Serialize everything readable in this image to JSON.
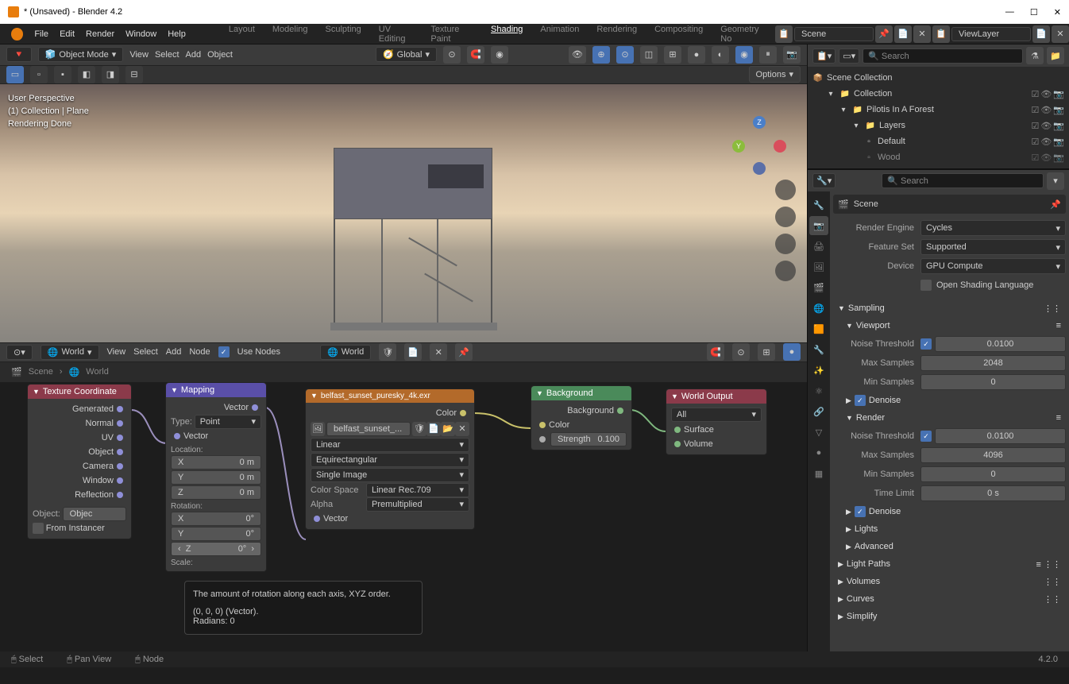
{
  "window": {
    "title": "* (Unsaved) - Blender 4.2"
  },
  "menu": [
    "File",
    "Edit",
    "Render",
    "Window",
    "Help"
  ],
  "workspaces": [
    "Layout",
    "Modeling",
    "Sculpting",
    "UV Editing",
    "Texture Paint",
    "Shading",
    "Animation",
    "Rendering",
    "Compositing",
    "Geometry No"
  ],
  "active_workspace": "Shading",
  "scene_name": "Scene",
  "viewlayer": "ViewLayer",
  "topbar": {
    "mode": "Object Mode",
    "items": [
      "View",
      "Select",
      "Add",
      "Object"
    ],
    "orientation": "Global",
    "options_label": "Options"
  },
  "viewport_info": [
    "User Perspective",
    "(1) Collection | Plane",
    "Rendering Done"
  ],
  "toolstrip_selection": true,
  "node_editor": {
    "world_dropdown": "World",
    "menu": [
      "View",
      "Select",
      "Add",
      "Node"
    ],
    "use_nodes": true,
    "breadcrumb": [
      "Scene",
      "World"
    ]
  },
  "nodes": {
    "texcoord": {
      "title": "Texture Coordinate",
      "outputs": [
        "Generated",
        "Normal",
        "UV",
        "Object",
        "Camera",
        "Window",
        "Reflection"
      ],
      "object_label": "Object:",
      "object_val": "Objec",
      "from_instancer": "From Instancer"
    },
    "mapping": {
      "title": "Mapping",
      "out": "Vector",
      "type_label": "Type:",
      "type_val": "Point",
      "vector_in": "Vector",
      "location": "Location:",
      "loc_x": "0 m",
      "loc_y": "0 m",
      "loc_z": "0 m",
      "rotation": "Rotation:",
      "rot_x": "0°",
      "rot_y": "0°",
      "rot_z": "0°",
      "scale": "Scale:"
    },
    "env": {
      "title": "belfast_sunset_puresky_4k.exr",
      "out": "Color",
      "file": "belfast_sunset_...",
      "interp": "Linear",
      "proj": "Equirectangular",
      "frame": "Single Image",
      "colorspace_lbl": "Color Space",
      "colorspace": "Linear Rec.709",
      "alpha_lbl": "Alpha",
      "alpha": "Premultiplied",
      "vec_in": "Vector"
    },
    "background": {
      "title": "Background",
      "out": "Background",
      "color_in": "Color",
      "strength_lbl": "Strength",
      "strength_val": "0.100"
    },
    "world_out": {
      "title": "World Output",
      "target": "All",
      "surface": "Surface",
      "volume": "Volume"
    }
  },
  "tooltip": {
    "line1": "The amount of rotation along each axis, XYZ order.",
    "line2": "(0, 0, 0) (Vector).",
    "line3": "Radians: 0"
  },
  "outliner": {
    "root": "Scene Collection",
    "items": [
      {
        "indent": 1,
        "label": "Collection",
        "icon": "📁"
      },
      {
        "indent": 2,
        "label": "Pilotis In A Forest",
        "icon": "📁"
      },
      {
        "indent": 3,
        "label": "Layers",
        "icon": "📁"
      },
      {
        "indent": 4,
        "label": "Default",
        "icon": "▫"
      },
      {
        "indent": 4,
        "label": "Wood",
        "icon": "▫",
        "dim": true
      }
    ]
  },
  "props": {
    "scene_label": "Scene",
    "render_engine_lbl": "Render Engine",
    "render_engine": "Cycles",
    "feature_set_lbl": "Feature Set",
    "feature_set": "Supported",
    "device_lbl": "Device",
    "device": "GPU Compute",
    "open_shading": "Open Shading Language",
    "sampling": "Sampling",
    "viewport": "Viewport",
    "noise_thresh_lbl": "Noise Threshold",
    "vp_noise": "0.0100",
    "max_samples_lbl": "Max Samples",
    "vp_max": "2048",
    "min_samples_lbl": "Min Samples",
    "vp_min": "0",
    "denoise": "Denoise",
    "render": "Render",
    "rd_noise": "0.0100",
    "rd_max": "4096",
    "rd_min": "0",
    "time_limit_lbl": "Time Limit",
    "time_limit": "0 s",
    "lights": "Lights",
    "advanced": "Advanced",
    "light_paths": "Light Paths",
    "volumes": "Volumes",
    "curves": "Curves",
    "simplify": "Simplify"
  },
  "status": {
    "select": "Select",
    "pan": "Pan View",
    "node": "Node",
    "version": "4.2.0"
  },
  "search_ph": "Search"
}
